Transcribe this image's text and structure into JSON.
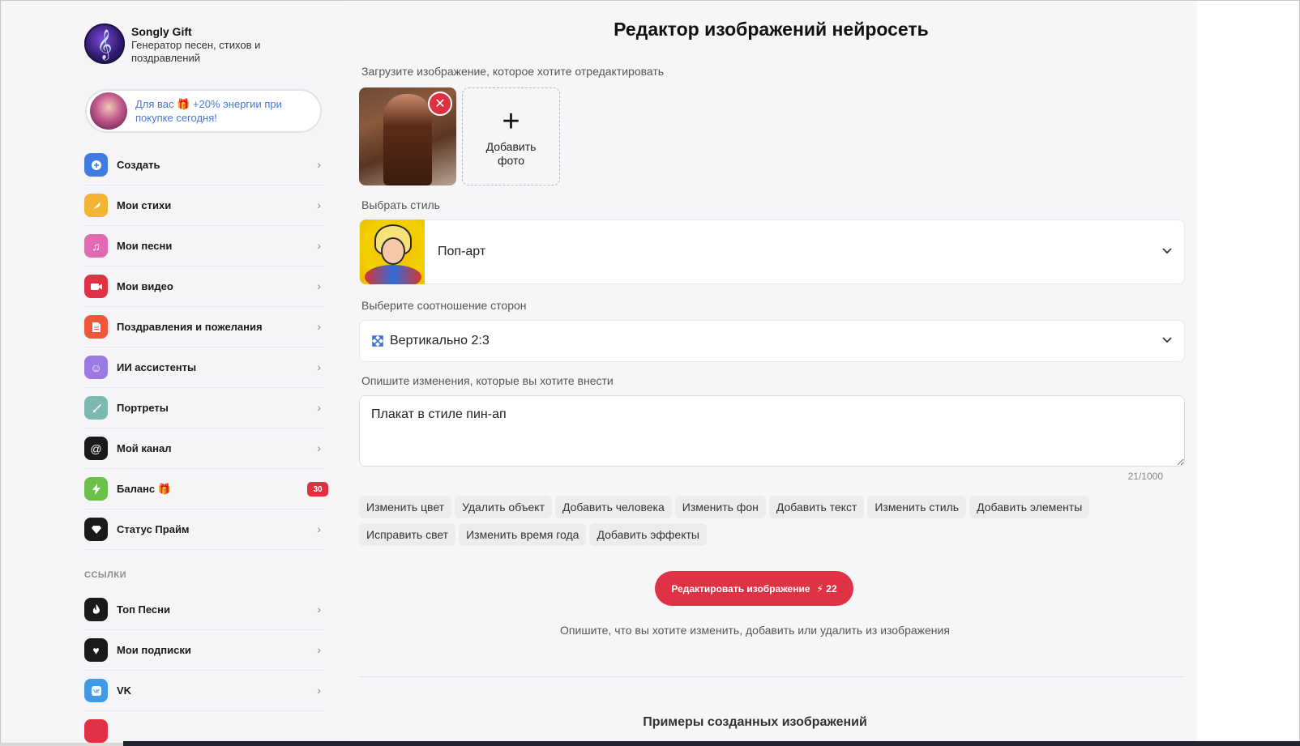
{
  "brand": {
    "title": "Songly Gift",
    "subtitle": "Генератор песен, стихов и поздравлений"
  },
  "promo": {
    "text": "Для вас 🎁 +20% энергии при покупке сегодня!"
  },
  "nav": {
    "items": [
      {
        "label": "Создать",
        "icon": "plus-circle-icon",
        "color": "#3f7be0"
      },
      {
        "label": "Мои стихи",
        "icon": "feather-icon",
        "color": "#f2b432"
      },
      {
        "label": "Мои песни",
        "icon": "music-note-icon",
        "color": "#e06bb0"
      },
      {
        "label": "Мои видео",
        "icon": "video-camera-icon",
        "color": "#e03245"
      },
      {
        "label": "Поздравления и пожелания",
        "icon": "document-icon",
        "color": "#f0573a"
      },
      {
        "label": "ИИ ассистенты",
        "icon": "smiley-icon",
        "color": "#9a7ae0"
      },
      {
        "label": "Портреты",
        "icon": "brush-icon",
        "color": "#7fb8b0"
      },
      {
        "label": "Мой канал",
        "icon": "at-sign-icon",
        "color": "#1a1a1a"
      },
      {
        "label": "Баланс 🎁",
        "icon": "lightning-icon",
        "color": "#6cc04a",
        "badge": "30"
      },
      {
        "label": "Статус Прайм",
        "icon": "diamond-icon",
        "color": "#1a1a1a"
      }
    ],
    "section_links": "ССЫЛКИ",
    "links": [
      {
        "label": "Топ Песни",
        "icon": "fire-icon",
        "color": "#1a1a1a"
      },
      {
        "label": "Мои подписки",
        "icon": "heart-icon",
        "color": "#1a1a1a"
      },
      {
        "label": "VK",
        "icon": "vk-icon",
        "color": "#3f9be8"
      }
    ]
  },
  "main": {
    "title": "Редактор изображений нейросеть",
    "upload_label": "Загрузите изображение, которое хотите отредактировать",
    "add_photo": "Добавить фото",
    "style_label": "Выбрать стиль",
    "style_value": "Поп-арт",
    "ratio_label": "Выберите соотношение сторон",
    "ratio_value": "Вертикально 2:3",
    "describe_label": "Опишите изменения, которые вы хотите внести",
    "prompt_value": "Плакат в стиле пин-ап",
    "counter": "21/1000",
    "chips": [
      "Изменить цвет",
      "Удалить объект",
      "Добавить человека",
      "Изменить фон",
      "Добавить текст",
      "Изменить стиль",
      "Добавить элементы",
      "Исправить свет",
      "Изменить время года",
      "Добавить эффекты"
    ],
    "cta_label": "Редактировать изображение",
    "cta_energy": "⚡ 22",
    "hint": "Опишите, что вы хотите изменить, добавить или удалить из изображения",
    "examples_title": "Примеры созданных изображений"
  }
}
